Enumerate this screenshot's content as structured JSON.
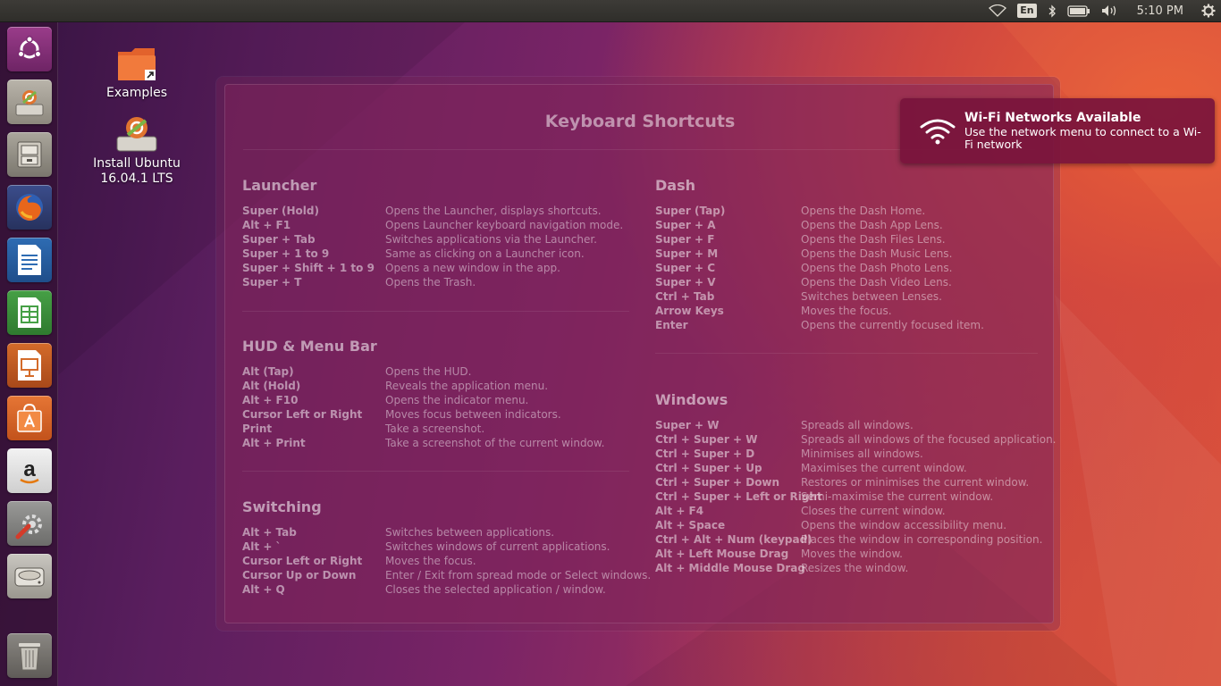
{
  "top_panel": {
    "language": "En",
    "clock": "5:10 PM",
    "indicators": [
      "wifi-icon",
      "bluetooth-icon",
      "battery-icon",
      "volume-icon",
      "gear-icon"
    ]
  },
  "launcher": {
    "items": [
      {
        "name": "dash-button",
        "icon": "ubuntu-logo-icon"
      },
      {
        "name": "install-ubuntu-launcher",
        "icon": "installer-icon"
      },
      {
        "name": "files-launcher",
        "icon": "file-cabinet-icon"
      },
      {
        "name": "firefox-launcher",
        "icon": "firefox-icon"
      },
      {
        "name": "writer-launcher",
        "icon": "libreoffice-writer-icon"
      },
      {
        "name": "calc-launcher",
        "icon": "libreoffice-calc-icon"
      },
      {
        "name": "impress-launcher",
        "icon": "libreoffice-impress-icon"
      },
      {
        "name": "software-center-launcher",
        "icon": "shopping-bag-icon"
      },
      {
        "name": "amazon-launcher",
        "icon": "amazon-icon"
      },
      {
        "name": "system-settings-launcher",
        "icon": "wrench-gear-icon"
      },
      {
        "name": "drive-launcher",
        "icon": "hard-drive-icon"
      },
      {
        "name": "trash-launcher",
        "icon": "trash-icon"
      }
    ]
  },
  "desktop": {
    "examples_label": "Examples",
    "install_label_line1": "Install Ubuntu",
    "install_label_line2": "16.04.1 LTS"
  },
  "shortcuts": {
    "title": "Keyboard Shortcuts",
    "launcher": {
      "heading": "Launcher",
      "rows": [
        {
          "key": "Super (Hold)",
          "desc": "Opens the Launcher, displays shortcuts."
        },
        {
          "key": "Alt + F1",
          "desc": "Opens Launcher keyboard navigation mode."
        },
        {
          "key": "Super + Tab",
          "desc": "Switches applications via the Launcher."
        },
        {
          "key": "Super + 1 to 9",
          "desc": "Same as clicking on a Launcher icon."
        },
        {
          "key": "Super + Shift + 1 to 9",
          "desc": "Opens a new window in the app."
        },
        {
          "key": "Super + T",
          "desc": "Opens the Trash."
        }
      ]
    },
    "hud": {
      "heading": "HUD & Menu Bar",
      "rows": [
        {
          "key": "Alt (Tap)",
          "desc": "Opens the HUD."
        },
        {
          "key": "Alt (Hold)",
          "desc": "Reveals the application menu."
        },
        {
          "key": "Alt + F10",
          "desc": "Opens the indicator menu."
        },
        {
          "key": "Cursor Left or Right",
          "desc": "Moves focus between indicators."
        },
        {
          "key": "Print",
          "desc": "Take a screenshot."
        },
        {
          "key": "Alt + Print",
          "desc": "Take a screenshot of the current window."
        }
      ]
    },
    "switching": {
      "heading": "Switching",
      "rows": [
        {
          "key": "Alt + Tab",
          "desc": "Switches between applications."
        },
        {
          "key": "Alt + `",
          "desc": "Switches windows of current applications."
        },
        {
          "key": "Cursor Left or Right",
          "desc": "Moves the focus."
        },
        {
          "key": "Cursor Up or Down",
          "desc": "Enter / Exit from spread mode or Select windows."
        },
        {
          "key": "Alt + Q",
          "desc": "Closes the selected application / window."
        }
      ]
    },
    "dash": {
      "heading": "Dash",
      "rows": [
        {
          "key": "Super (Tap)",
          "desc": "Opens the Dash Home."
        },
        {
          "key": "Super + A",
          "desc": "Opens the Dash App Lens."
        },
        {
          "key": "Super + F",
          "desc": "Opens the Dash Files Lens."
        },
        {
          "key": "Super + M",
          "desc": "Opens the Dash Music Lens."
        },
        {
          "key": "Super + C",
          "desc": "Opens the Dash Photo Lens."
        },
        {
          "key": "Super + V",
          "desc": "Opens the Dash Video Lens."
        },
        {
          "key": "Ctrl + Tab",
          "desc": "Switches between Lenses."
        },
        {
          "key": "Arrow Keys",
          "desc": "Moves the focus."
        },
        {
          "key": "Enter",
          "desc": "Opens the currently focused item."
        }
      ]
    },
    "windows": {
      "heading": "Windows",
      "rows": [
        {
          "key": "Super + W",
          "desc": "Spreads all windows."
        },
        {
          "key": "Ctrl + Super + W",
          "desc": "Spreads all windows of the focused application."
        },
        {
          "key": "Ctrl + Super + D",
          "desc": "Minimises all windows."
        },
        {
          "key": "Ctrl + Super + Up",
          "desc": "Maximises the current window."
        },
        {
          "key": "Ctrl + Super + Down",
          "desc": "Restores or minimises the current window."
        },
        {
          "key": "Ctrl + Super + Left or Right",
          "desc": "Semi-maximise the current window."
        },
        {
          "key": "Alt + F4",
          "desc": "Closes the current window."
        },
        {
          "key": "Alt + Space",
          "desc": "Opens the window accessibility menu."
        },
        {
          "key": "Ctrl + Alt + Num (keypad)",
          "desc": "Places the window in corresponding position."
        },
        {
          "key": "Alt + Left Mouse Drag",
          "desc": "Moves the window."
        },
        {
          "key": "Alt + Middle Mouse Drag",
          "desc": "Resizes the window."
        }
      ]
    }
  },
  "notification": {
    "title": "Wi-Fi Networks Available",
    "body": "Use the network menu to connect to a Wi-Fi network",
    "icon": "wifi-icon"
  }
}
